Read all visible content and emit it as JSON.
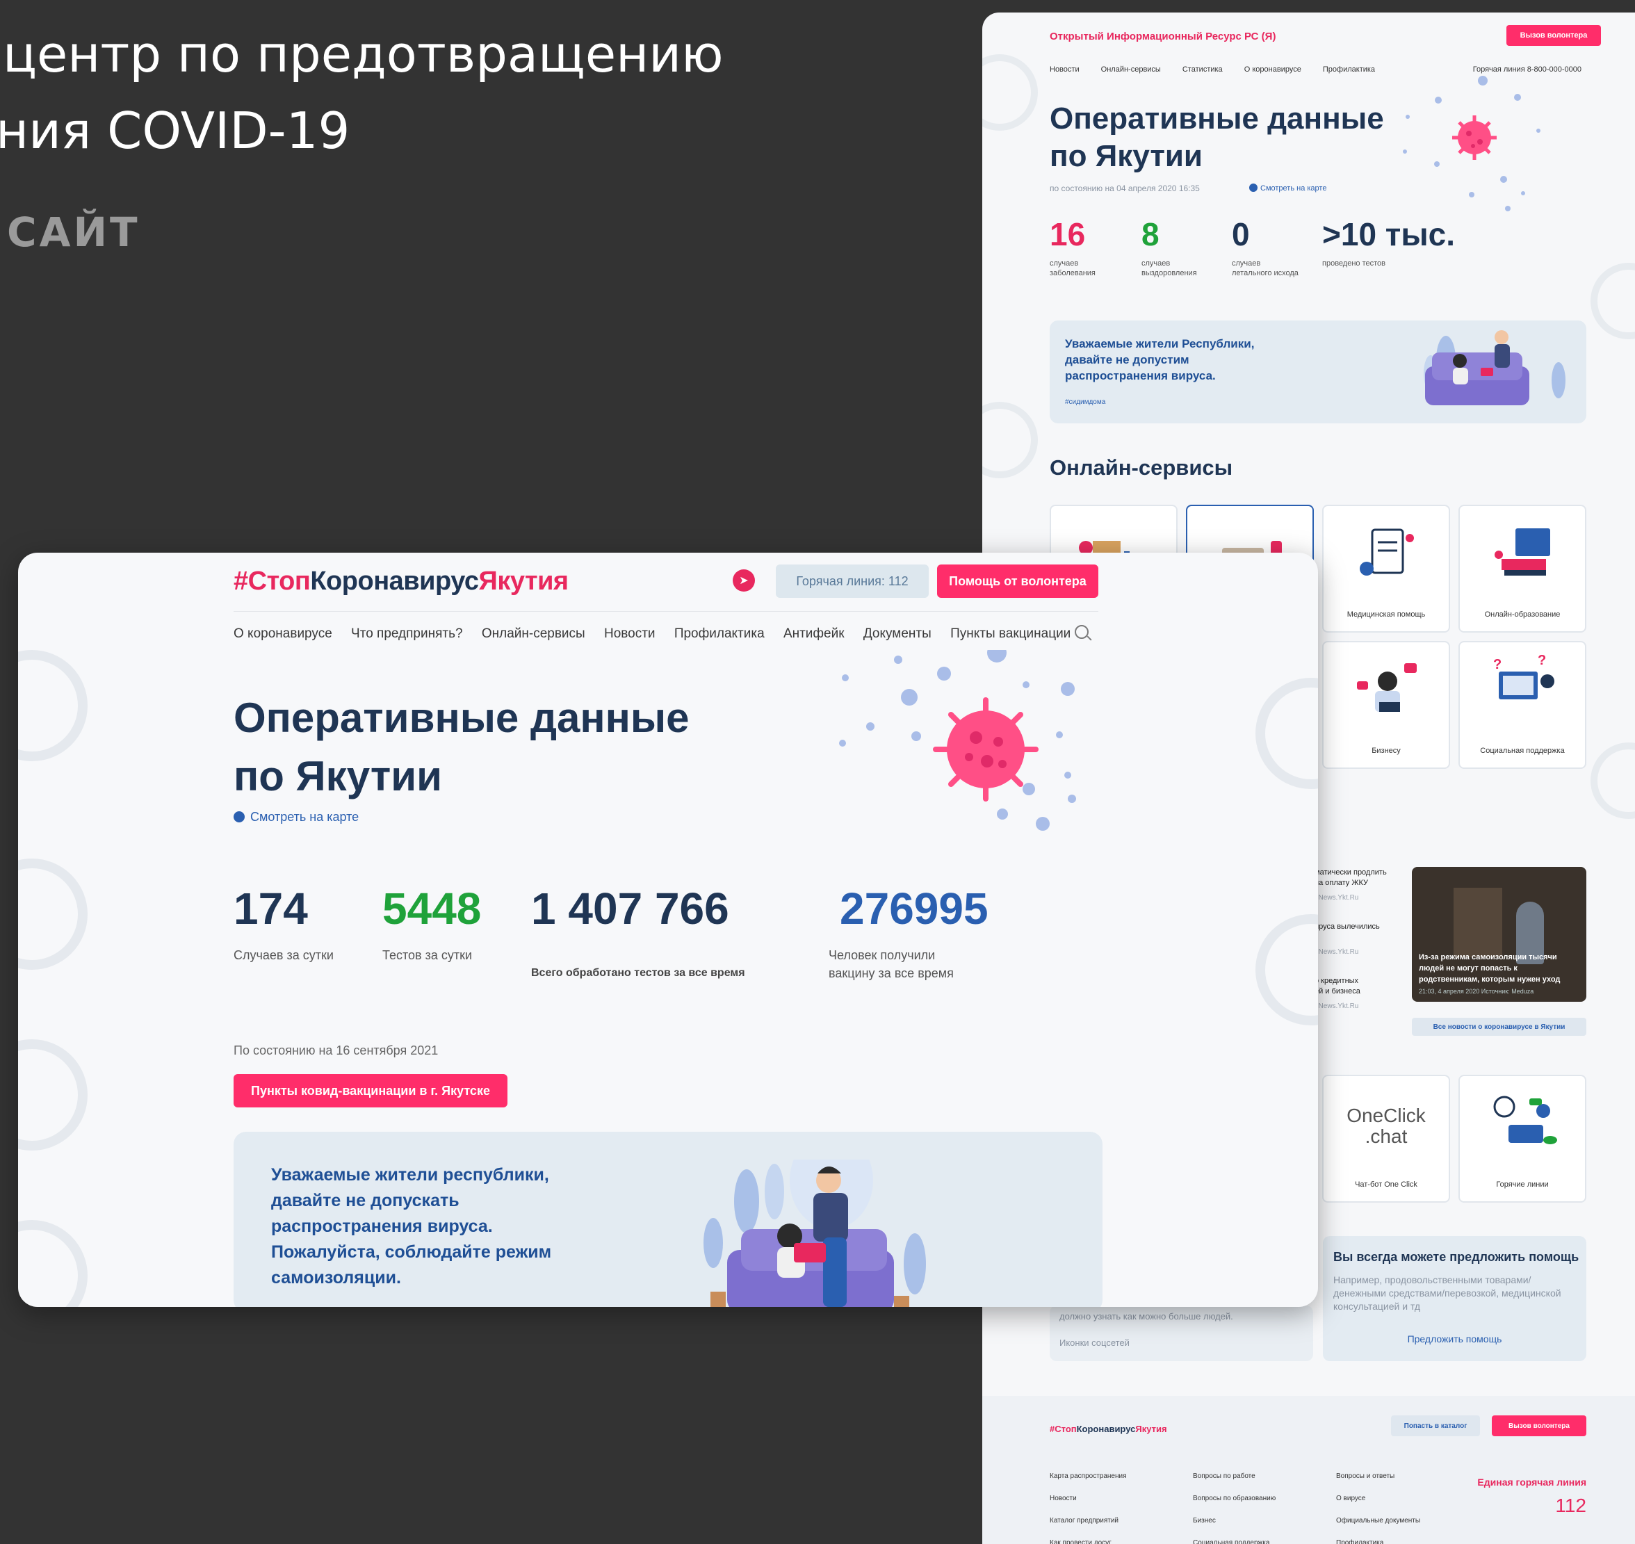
{
  "presentation": {
    "title_line1": "центр по предотвращению",
    "title_line2": "ния COVID-19",
    "subtitle": "САЙТ"
  },
  "back_site": {
    "brand": "Открытый Информационный Ресурс РС (Я)",
    "volunteer_button": "Вызов волонтера",
    "nav": [
      "Новости",
      "Онлайн-сервисы",
      "Статистика",
      "О коронавирусе",
      "Профилактика"
    ],
    "hotline": "Горячая линия  8-800-000-0000",
    "heading_line1": "Оперативные данные",
    "heading_line2": "по Якутии",
    "as_of": "по состоянию на 04 апреля 2020 16:35",
    "map_link": "Смотреть на карте",
    "stats": [
      {
        "value": "16",
        "label1": "случаев",
        "label2": "заболевания",
        "color": "#e8285e"
      },
      {
        "value": "8",
        "label1": "случаев",
        "label2": "выздоровления",
        "color": "#1fa23a"
      },
      {
        "value": "0",
        "label1": "случаев",
        "label2": "летального исхода",
        "color": "#1f3554"
      },
      {
        "value": ">10 тыс.",
        "label1": "проведено тестов",
        "label2": "",
        "color": "#1f3554"
      }
    ],
    "banner_line1": "Уважаемые жители Республики,",
    "banner_line2": "давайте не допустим",
    "banner_line3": "распространения вируса.",
    "banner_tag": "#сидимдома",
    "services_title": "Онлайн-сервисы",
    "service_cards": [
      "Медицинская помощь",
      "Онлайн-образование",
      "Бизнесу",
      "Социальная поддержка",
      "Чат-бот One Click",
      "Горячие линии"
    ],
    "oneclick_logo_line1": "OneClick",
    "oneclick_logo_line2": ".chat",
    "news": [
      {
        "line1": "матически продлить",
        "line2": "на оплату ЖКУ",
        "src": ": News.Ykt.Ru"
      },
      {
        "line1": "ируса вылечились",
        "line2": "",
        "src": ": News.Ykt.Ru"
      },
      {
        "line1": "о кредитных",
        "line2": "ей и бизнеса",
        "src": ": News.Ykt.Ru"
      }
    ],
    "photo_news_title": "Из-за режима самоизоляции тысячи людей не могут попасть к родственникам, которым нужен уход",
    "photo_news_meta": "21:03, 4 апреля 2020  Источник: Meduza",
    "all_news": "Все новости о коронавирусе в Якутии",
    "help_title": "Вы всегда можете предложить помощь",
    "help_text": "Например, продовольственными товарами/денежными средствами/перевозкой, медицинской консультацией и тд",
    "help_link": "Предложить помощь",
    "social_text": "должно узнать как можно больше людей.",
    "social_icons": "Иконки соцсетей",
    "footer": {
      "brand_pink1": "#Стоп",
      "brand_dark": "Коронавирус",
      "brand_pink2": "Якутия",
      "catalog_button": "Попасть в каталог",
      "volunteer_button": "Вызов волонтера",
      "col1": [
        "Карта распространения",
        "Новости",
        "Каталог предприятий",
        "Как провести досуг"
      ],
      "col2": [
        "Вопросы по работе",
        "Вопросы по образованию",
        "Бизнес",
        "Социальная поддержка"
      ],
      "col3": [
        "Вопросы и ответы",
        "О вирусе",
        "Официальные документы",
        "Профилактика"
      ],
      "hotline_label": "Единая горячая линия",
      "hotline_number": "112"
    }
  },
  "front_site": {
    "brand_part1": "#Стоп",
    "brand_part2": "Коронавирус",
    "brand_part3": "Якутия",
    "hotline_button": "Горячая линия: 112",
    "volunteer_button": "Помощь от волонтера",
    "nav": [
      "О коронавирусе",
      "Что предпринять?",
      "Онлайн-сервисы",
      "Новости",
      "Профилактика",
      "Антифейк",
      "Документы",
      "Пункты вакцинации"
    ],
    "heading_line1": "Оперативные данные",
    "heading_line2": "по Якутии",
    "map_link": "Смотреть на карте",
    "stats": [
      {
        "value": "174",
        "label1": "Случаев за сутки",
        "label2": "",
        "color": "#1f3554"
      },
      {
        "value": "5448",
        "label1": "Тестов за сутки",
        "label2": "",
        "color": "#1fa23a"
      },
      {
        "value": "1 407 766",
        "label1": "Всего обработано тестов за все время",
        "label2": "",
        "color": "#1f3554"
      },
      {
        "value": "276995",
        "label1": "Человек получили",
        "label2": "вакцину за все время",
        "color": "#2a5fb0"
      }
    ],
    "as_of": "По состоянию на 16 сентября 2021",
    "vaccination_button": "Пункты ковид-вакцинации в г. Якутске",
    "banner_line1": "Уважаемые жители республики,",
    "banner_line2": "давайте не допускать",
    "banner_line3": "распространения вируса.",
    "banner_line4": "Пожалуйста, соблюдайте режим",
    "banner_line5": "самоизоляции.",
    "colors": {
      "accent": "#ff2d6a",
      "navy": "#1f3554",
      "green": "#1fa23a",
      "blue": "#2a5fb0"
    }
  }
}
